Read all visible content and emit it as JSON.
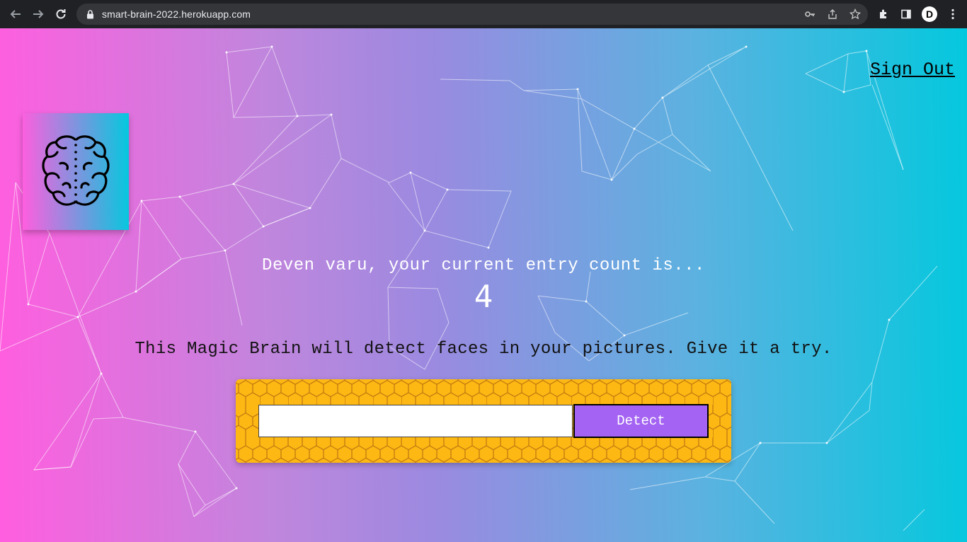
{
  "browser": {
    "url": "smart-brain-2022.herokuapp.com",
    "profile_initial": "D"
  },
  "nav": {
    "sign_out": "Sign Out"
  },
  "main": {
    "greeting": "Deven varu, your current entry count is...",
    "entry_count": "4",
    "tagline": "This Magic Brain will detect faces in your pictures. Give it a try.",
    "image_url_input": {
      "value": "",
      "placeholder": ""
    },
    "detect_label": "Detect"
  },
  "colors": {
    "gradient_start": "#ff5edf",
    "gradient_end": "#04c8de",
    "panel": "#fdb813",
    "button": "#a463f2"
  }
}
